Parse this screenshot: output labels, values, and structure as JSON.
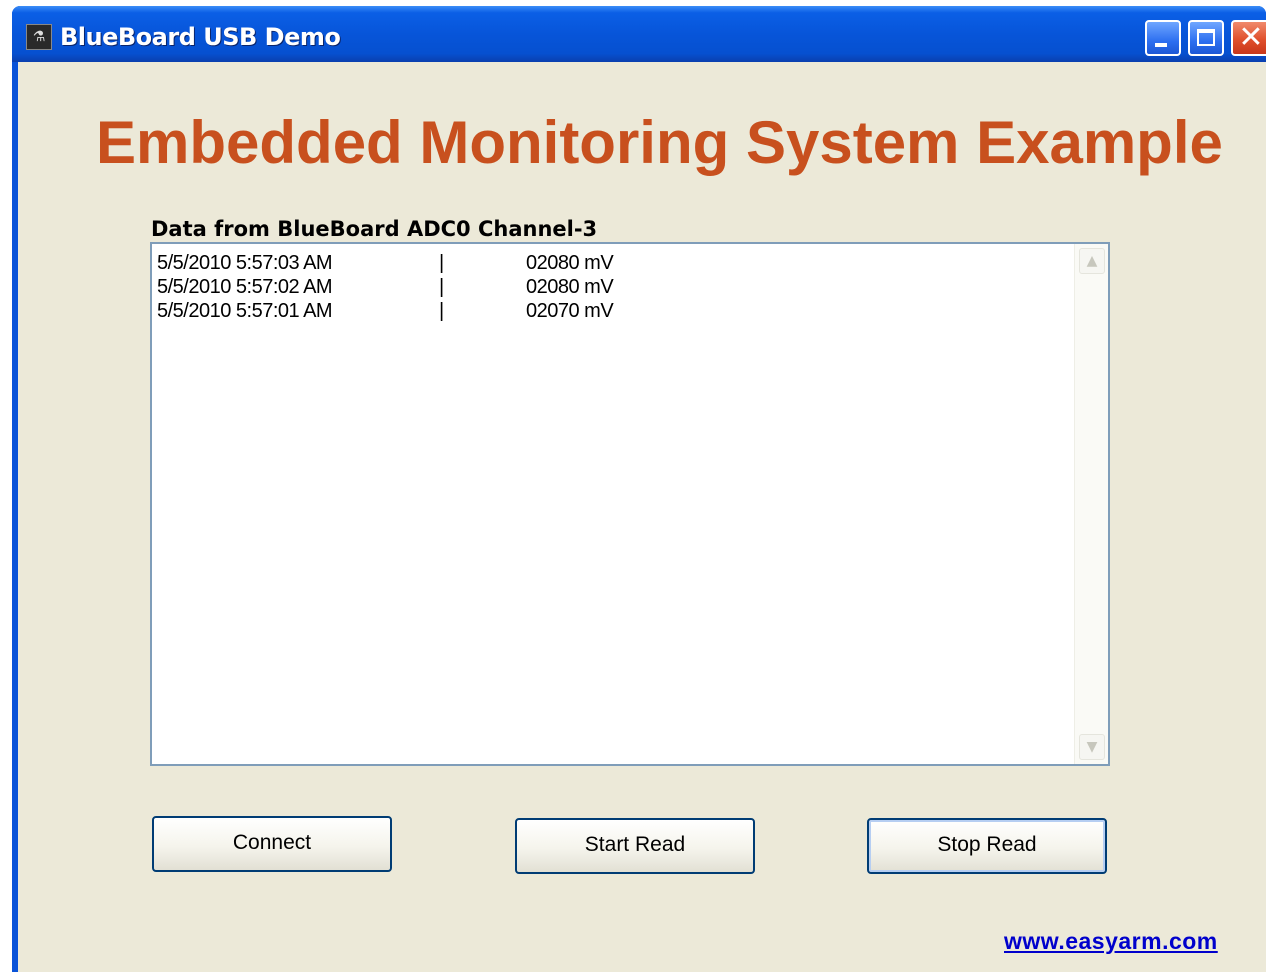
{
  "window": {
    "title": "BlueBoard USB Demo",
    "app_icon_glyph": "⚗",
    "controls": {
      "minimize": "minimize-icon",
      "maximize": "maximize-icon",
      "close": "close-icon",
      "close_glyph": "✕"
    }
  },
  "main": {
    "heading": "Embedded Monitoring System Example",
    "list_label": "Data from BlueBoard ADC0 Channel-3",
    "rows": [
      {
        "time": "5/5/2010 5:57:03 AM",
        "sep": "|",
        "value": "02080 mV"
      },
      {
        "time": "5/5/2010 5:57:02 AM",
        "sep": "|",
        "value": "02080 mV"
      },
      {
        "time": "5/5/2010 5:57:01 AM",
        "sep": "|",
        "value": "02070 mV"
      }
    ],
    "scroll_up_glyph": "▲",
    "scroll_down_glyph": "▼"
  },
  "buttons": {
    "connect": "Connect",
    "start_read": "Start Read",
    "stop_read": "Stop Read"
  },
  "footer": {
    "link": "www.easyarm.com"
  },
  "colors": {
    "heading": "#c8501e",
    "titlebar": "#0755d9",
    "client": "#ece9d8",
    "link": "#0000cc"
  }
}
